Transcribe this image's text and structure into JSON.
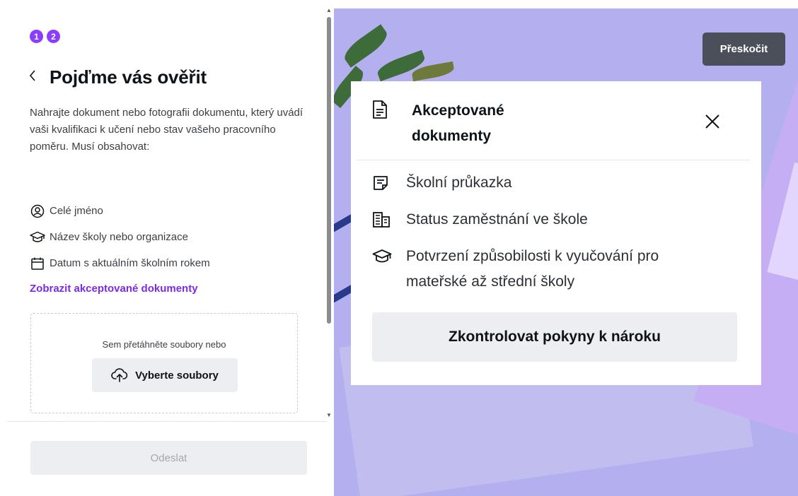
{
  "steps": [
    "1",
    "2"
  ],
  "page_title": "Pojďme vás ověřit",
  "description": "Nahrajte dokument nebo fotografii dokumentu, který uvádí vaši kvalifikaci k učení nebo stav vašeho pracovního poměru. Musí obsahovat:",
  "requirements": [
    {
      "icon": "person-circle-icon",
      "label": "Celé jméno"
    },
    {
      "icon": "graduation-cap-icon",
      "label": "Název školy nebo organizace"
    },
    {
      "icon": "calendar-icon",
      "label": "Datum s aktuálním školním rokem"
    }
  ],
  "show_accepted_link": "Zobrazit akceptované dokumenty",
  "upload": {
    "drop_text": "Sem přetáhněte soubory nebo",
    "choose_label": "Vyberte soubory"
  },
  "submit_label": "Odeslat",
  "skip_label": "Přeskočit",
  "popup": {
    "title": "Akceptované dokumenty",
    "items": [
      {
        "icon": "note-icon",
        "label": "Školní průkazka"
      },
      {
        "icon": "building-icon",
        "label": "Status zaměstnání ve škole"
      },
      {
        "icon": "graduation-cap-icon",
        "label": "Potvrzení způsobilosti k vyučování pro mateřské až střední školy"
      }
    ],
    "review_button": "Zkontrolovat pokyny k nároku"
  },
  "colors": {
    "accent": "#7d2ae8",
    "step_badge": "#8b3dff",
    "background": "#b4b0f0",
    "skip_button": "#4a4f5a"
  }
}
